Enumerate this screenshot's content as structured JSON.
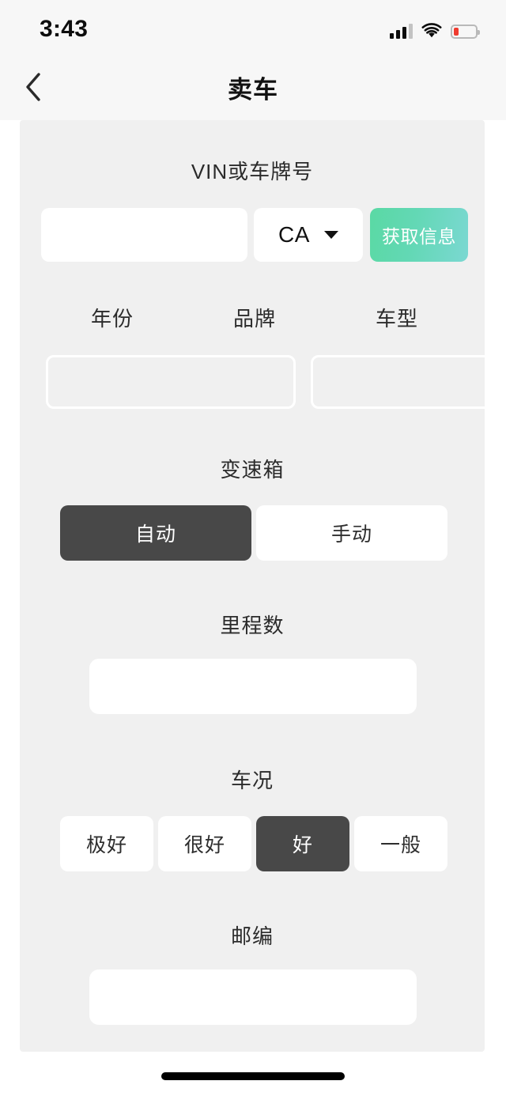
{
  "status_bar": {
    "time": "3:43",
    "signal_icon": "cellular-signal-icon",
    "signal_bars_filled": 3,
    "signal_bars_total": 4,
    "wifi_icon": "wifi-icon",
    "battery_icon": "battery-low-icon",
    "battery_level_percent": 22,
    "battery_color": "#ef3b2f"
  },
  "nav": {
    "back_icon": "chevron-left-icon",
    "title": "卖车"
  },
  "form": {
    "vin": {
      "label": "VIN或车牌号",
      "input_value": "",
      "input_placeholder": "",
      "state_select_value": "CA",
      "state_caret_icon": "caret-down-icon",
      "fetch_button_label": "获取信息",
      "fetch_button_gradient_from": "#5ad9a4",
      "fetch_button_gradient_to": "#7bd8d2"
    },
    "vehicle": {
      "year_label": "年份",
      "year_value": "",
      "brand_label": "品牌",
      "brand_value": "",
      "model_label": "车型",
      "model_value": ""
    },
    "transmission": {
      "label": "变速箱",
      "options": [
        {
          "label": "自动",
          "selected": true
        },
        {
          "label": "手动",
          "selected": false
        }
      ]
    },
    "mileage": {
      "label": "里程数",
      "value": "",
      "placeholder": ""
    },
    "condition": {
      "label": "车况",
      "options": [
        {
          "label": "极好",
          "selected": false
        },
        {
          "label": "很好",
          "selected": false
        },
        {
          "label": "好",
          "selected": true
        },
        {
          "label": "一般",
          "selected": false
        }
      ]
    },
    "zip": {
      "label": "邮编",
      "value": "",
      "placeholder": ""
    }
  },
  "theme": {
    "page_background": "#ffffff",
    "panel_background": "#f0f0f0",
    "selected_segment": "#484848",
    "text_primary": "#2b2b2b"
  }
}
